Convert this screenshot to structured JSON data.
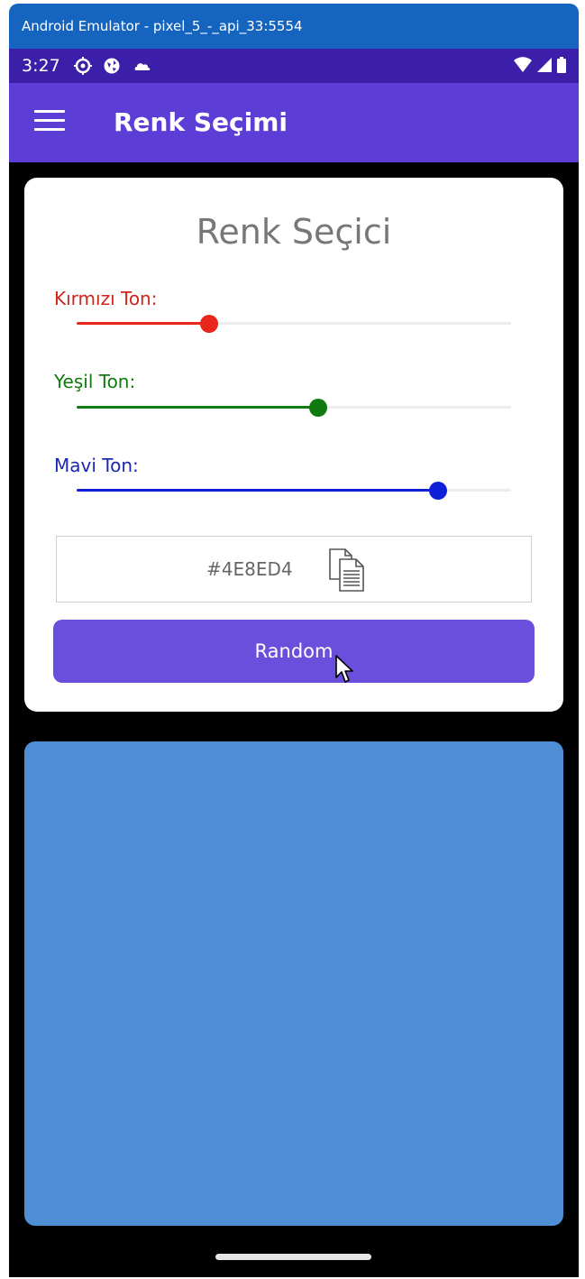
{
  "window": {
    "title": "Android Emulator - pixel_5_-_api_33:5554"
  },
  "status_bar": {
    "time": "3:27",
    "icons_left": [
      "settings-icon",
      "globe-icon",
      "cloud-icon"
    ],
    "icons_right": [
      "wifi-icon",
      "signal-icon",
      "battery-icon"
    ]
  },
  "app_bar": {
    "title": "Renk Seçimi",
    "menu_icon": "hamburger-menu-icon"
  },
  "card": {
    "title": "Renk Seçici",
    "sliders": [
      {
        "label": "Kırmızı Ton:",
        "value": 78,
        "max": 255,
        "color": "#e8261b",
        "label_color": "#d0251b"
      },
      {
        "label": "Yeşil Ton:",
        "value": 142,
        "max": 255,
        "color": "#107a10",
        "label_color": "#107a10"
      },
      {
        "label": "Mavi Ton:",
        "value": 212,
        "max": 255,
        "color": "#1020d8",
        "label_color": "#1b27b0"
      }
    ],
    "hex_value": "#4E8ED4",
    "copy_icon": "copy-icon",
    "random_label": "Random"
  },
  "preview": {
    "color": "#4E8ED4"
  },
  "colors": {
    "appbar": "#5c3dd6",
    "statusbar": "#3c1fa8",
    "button": "#6a4fdc",
    "window_title": "#1565c0"
  }
}
